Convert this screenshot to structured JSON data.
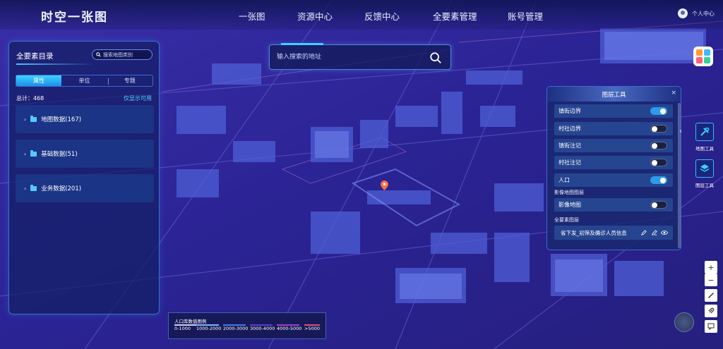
{
  "app": {
    "title": "时空一张图"
  },
  "nav": {
    "items": [
      "一张图",
      "资源中心",
      "反馈中心",
      "全要素管理",
      "账号管理"
    ],
    "user_label": "个人中心"
  },
  "catalog": {
    "title": "全要素目录",
    "search_placeholder": "搜索地图类别",
    "tabs": [
      "属性",
      "单位",
      "专题"
    ],
    "active_tab": "属性",
    "total": "总计：468",
    "only_visible": "仅显示可用",
    "items": [
      {
        "label": "地图数据(167)"
      },
      {
        "label": "基础数据(51)"
      },
      {
        "label": "业务数据(201)"
      }
    ]
  },
  "address_search": {
    "placeholder": "输入搜索的地址"
  },
  "layer_tool": {
    "title": "图层工具",
    "close": "×",
    "layers": [
      {
        "label": "镇街边界",
        "on": true
      },
      {
        "label": "村社边界",
        "on": false
      },
      {
        "label": "镇街注记",
        "on": false
      },
      {
        "label": "村社注记",
        "on": false
      },
      {
        "label": "人口",
        "on": true
      }
    ],
    "imagery_section": "影像地图图层",
    "imagery_layer": {
      "label": "影像地图",
      "on": false
    },
    "feature_section": "全要素图层",
    "feature_row": "省下发_初筛及确诊人员信息"
  },
  "side_tools": [
    {
      "label": "地图工具",
      "icon": "wrench-icon"
    },
    {
      "label": "图层工具",
      "icon": "layers-icon"
    }
  ],
  "zoom": {
    "in": "+",
    "out": "−"
  },
  "legend": {
    "title": "人口库数值图例",
    "items": [
      {
        "label": "0-1000",
        "color": "#c9d4ff"
      },
      {
        "label": "1000-2000",
        "color": "#7fb6ff"
      },
      {
        "label": "2000-3000",
        "color": "#3d7ae8"
      },
      {
        "label": "3000-4000",
        "color": "#5a3fd0"
      },
      {
        "label": "4000-5000",
        "color": "#a03fd0"
      },
      {
        "label": ">5000",
        "color": "#e0507a"
      }
    ]
  },
  "colors": {
    "accent": "#3fd0ff",
    "map_bg": "#2a1f8a",
    "toggle_on": "#2e9be9"
  }
}
